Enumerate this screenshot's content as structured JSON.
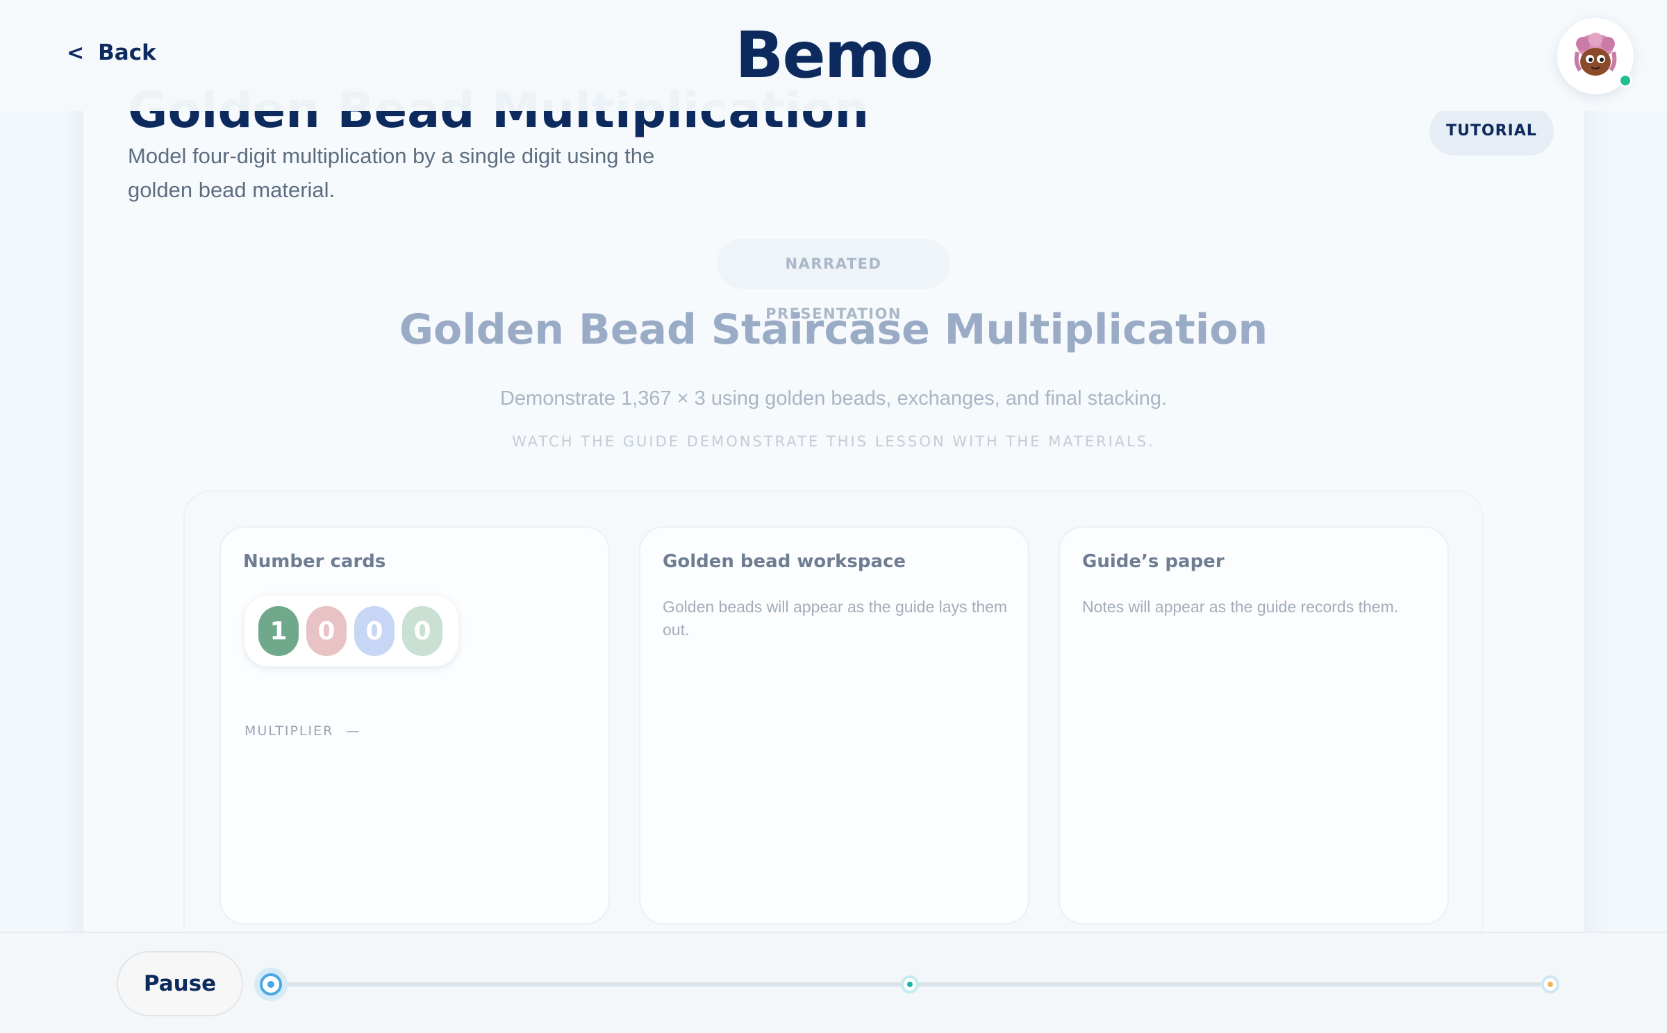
{
  "header": {
    "back_label": "Back",
    "back_icon": "<",
    "brand": "Bemo",
    "avatar_icon": "avatar-character-icon"
  },
  "lesson": {
    "title": "Golden Bead Multiplication",
    "description": "Model four-digit multiplication by a single digit using the golden bead material.",
    "badge": "TUTORIAL"
  },
  "presentation": {
    "mode_label": "NARRATED PRESENTATION",
    "title": "Golden Bead Staircase Multiplication",
    "subtitle": "Demonstrate 1,367 × 3 using golden beads, exchanges, and final stacking.",
    "hint": "WATCH THE GUIDE DEMONSTRATE THIS LESSON WITH THE MATERIALS."
  },
  "panels": {
    "number_cards": {
      "title": "Number cards",
      "cards": [
        {
          "digit": "1",
          "color": "#6fa88a"
        },
        {
          "digit": "0",
          "color": "#e8c2c4"
        },
        {
          "digit": "0",
          "color": "#c7d6f5"
        },
        {
          "digit": "0",
          "color": "#c9e0d3"
        }
      ],
      "multiplier_label": "MULTIPLIER",
      "multiplier_value": "—"
    },
    "workspace": {
      "title": "Golden bead workspace",
      "text": "Golden beads will appear as the guide lays them out."
    },
    "paper": {
      "title": "Guide’s paper",
      "text": "Notes will appear as the guide records them."
    }
  },
  "playback": {
    "pause_label": "Pause",
    "progress": 0.0
  },
  "colors": {
    "brand_navy": "#0d2a5e",
    "online": "#1fbf8f",
    "progress_accent": "#4aa8e3"
  }
}
